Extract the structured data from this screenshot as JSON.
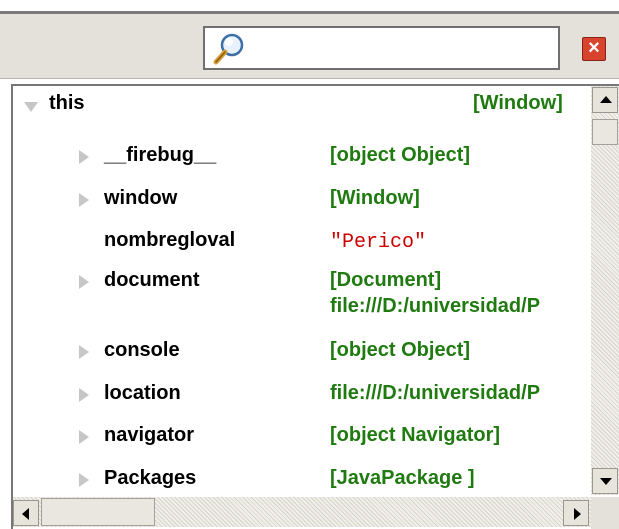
{
  "search": {
    "value": "",
    "placeholder": ""
  },
  "tree": {
    "root": {
      "key": "this",
      "value": "[Window]"
    },
    "children": [
      {
        "key": "__firebug__",
        "value": "[object Object]",
        "expandable": true
      },
      {
        "key": "window",
        "value": "[Window]",
        "expandable": true
      },
      {
        "key": "nombregloval",
        "value": "\"Perico\"",
        "expandable": false,
        "type": "string"
      },
      {
        "key": "document",
        "value": "[Document]",
        "value_line2": "file:///D:/universidad/P",
        "expandable": true
      },
      {
        "key": "console",
        "value": "[object Object]",
        "expandable": true
      },
      {
        "key": "location",
        "value": "file:///D:/universidad/P",
        "expandable": true
      },
      {
        "key": "navigator",
        "value": "[object Navigator]",
        "expandable": true
      },
      {
        "key": "Packages",
        "value": "[JavaPackage ]",
        "expandable": true
      }
    ]
  },
  "icons": {
    "search": "magnifier-icon",
    "close": "close-icon",
    "expand": "triangle-right-icon",
    "collapse": "triangle-down-icon"
  },
  "colors": {
    "value_green": "#1f7a10",
    "string_red": "#cc0000",
    "close_red": "#d8432e"
  }
}
